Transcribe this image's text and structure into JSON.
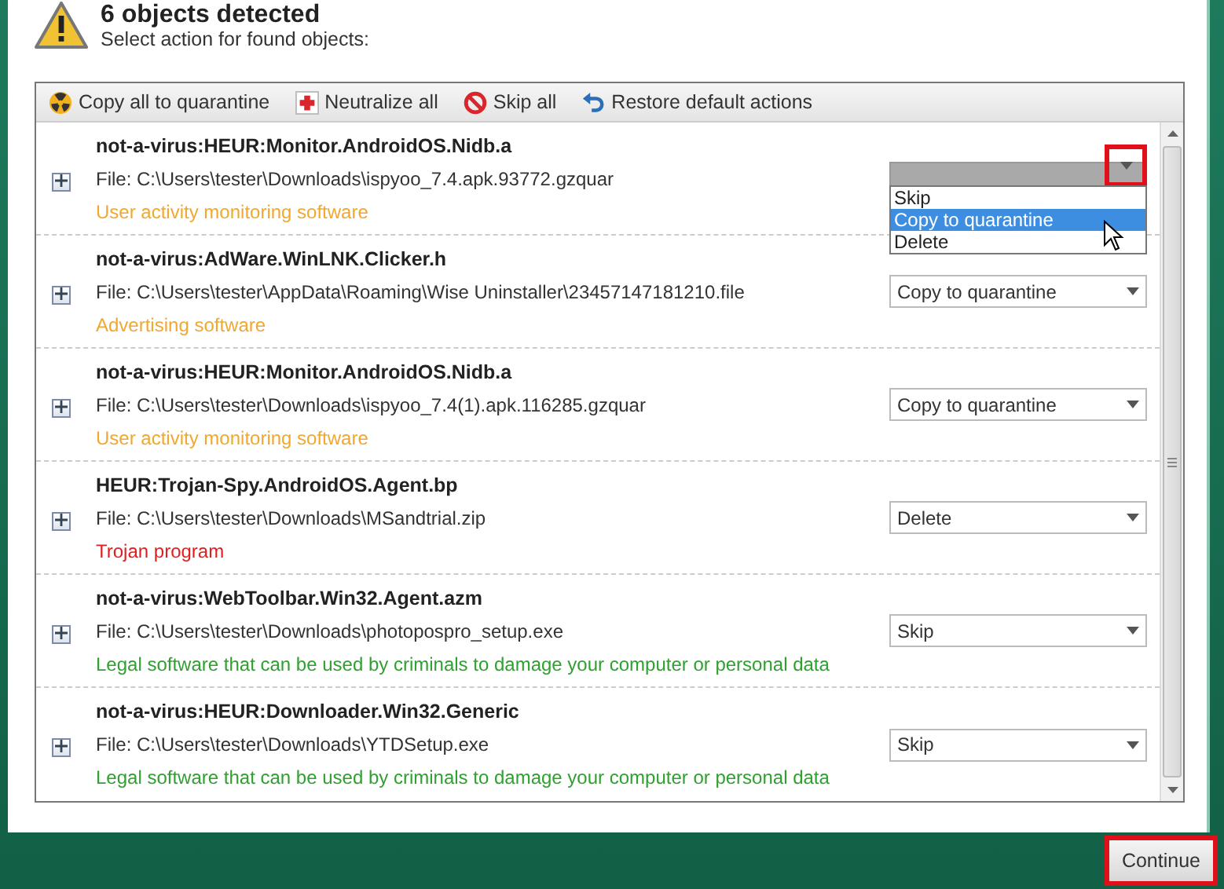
{
  "header": {
    "title": "6 objects detected",
    "subtitle": "Select action for found objects:"
  },
  "toolbar": [
    {
      "label": "Copy all to quarantine",
      "kind": "quarantine"
    },
    {
      "label": "Neutralize all",
      "kind": "neutralize"
    },
    {
      "label": "Skip all",
      "kind": "skip"
    },
    {
      "label": "Restore default actions",
      "kind": "restore"
    }
  ],
  "objects": [
    {
      "name": "not-a-virus:HEUR:Monitor.AndroidOS.Nidb.a",
      "file": "File: C:\\Users\\tester\\Downloads\\ispyoo_7.4.apk.93772.gzquar",
      "category": "User activity monitoring software",
      "color": "#f0a830",
      "menu": [
        {
          "label": "Skip",
          "selected": false
        },
        {
          "label": "Copy to quarantine",
          "selected": true
        },
        {
          "label": "Delete",
          "selected": false
        }
      ]
    },
    {
      "name": "not-a-virus:AdWare.WinLNK.Clicker.h",
      "file": "File: C:\\Users\\tester\\AppData\\Roaming\\Wise Uninstaller\\23457147181210.file",
      "category": "Advertising software",
      "color": "#f0a830",
      "action": "Copy to quarantine"
    },
    {
      "name": "not-a-virus:HEUR:Monitor.AndroidOS.Nidb.a",
      "file": "File: C:\\Users\\tester\\Downloads\\ispyoo_7.4(1).apk.116285.gzquar",
      "category": "User activity monitoring software",
      "color": "#f0a830",
      "action": "Copy to quarantine"
    },
    {
      "name": "HEUR:Trojan-Spy.AndroidOS.Agent.bp",
      "file": "File: C:\\Users\\tester\\Downloads\\MSandtrial.zip",
      "category": "Trojan program",
      "color": "#e02020",
      "action": "Delete"
    },
    {
      "name": "not-a-virus:WebToolbar.Win32.Agent.azm",
      "file": "File: C:\\Users\\tester\\Downloads\\photopospro_setup.exe",
      "category": "Legal software that can be used by criminals to damage your computer or personal data",
      "color": "#30a030",
      "action": "Skip"
    },
    {
      "name": "not-a-virus:HEUR:Downloader.Win32.Generic",
      "file": "File: C:\\Users\\tester\\Downloads\\YTDSetup.exe",
      "category": "Legal software that can be used by criminals to damage your computer or personal data",
      "color": "#30a030",
      "action": "Skip"
    }
  ],
  "footer": {
    "button": "Continue"
  }
}
